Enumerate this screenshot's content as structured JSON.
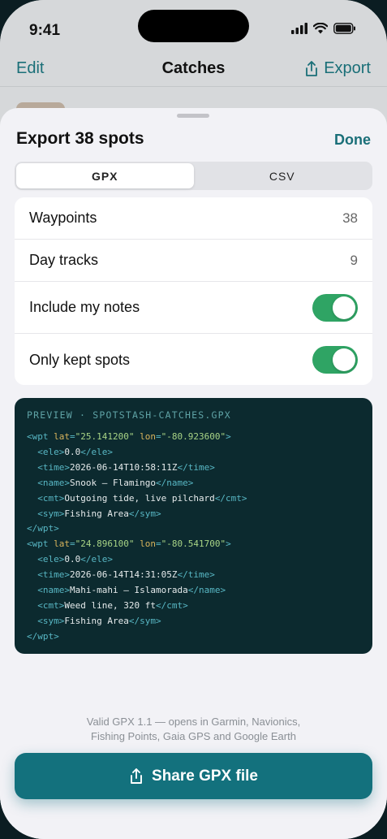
{
  "status_bar": {
    "time": "9:41"
  },
  "nav": {
    "edit_label": "Edit",
    "title": "Catches",
    "export_label": "Export"
  },
  "sheet": {
    "title": "Export 38 spots",
    "done_label": "Done",
    "segments": [
      {
        "label": "GPX",
        "selected": true
      },
      {
        "label": "CSV",
        "selected": false
      }
    ],
    "rows": [
      {
        "label": "Waypoints",
        "value": "38"
      },
      {
        "label": "Day tracks",
        "value": "9"
      },
      {
        "label": "Include my notes",
        "toggle_on": true
      },
      {
        "label": "Only kept spots",
        "toggle_on": true
      }
    ],
    "preview": {
      "title": "PREVIEW · SPOTSTASH-CATCHES.GPX",
      "waypoints": [
        {
          "lat": "25.141200",
          "lon": "-80.923600",
          "ele": "0.0",
          "time": "2026-06-14T10:58:11Z",
          "name": "Snook — Flamingo",
          "cmt": "Outgoing tide, live pilchard",
          "sym": "Fishing Area"
        },
        {
          "lat": "24.896100",
          "lon": "-80.541700",
          "ele": "0.0",
          "time": "2026-06-14T14:31:05Z",
          "name": "Mahi-mahi — Islamorada",
          "cmt": "Weed line, 320 ft",
          "sym": "Fishing Area"
        }
      ]
    },
    "footer_line1": "Valid GPX 1.1 — opens in Garmin, Navionics,",
    "footer_line2": "Fishing Points, Gaia GPS and Google Earth",
    "share_label": "Share GPX file"
  },
  "colors": {
    "accent": "#13717d",
    "toggle_on": "#2fa464",
    "code_bg": "#0c2a2f"
  }
}
